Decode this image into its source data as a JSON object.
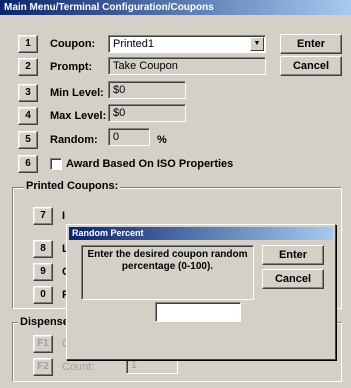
{
  "window": {
    "title": "Main Menu/Terminal Configuration/Coupons"
  },
  "rows": {
    "coupon": {
      "num": "1",
      "label": "Coupon:",
      "value": "Printed1"
    },
    "prompt": {
      "num": "2",
      "label": "Prompt:",
      "value": "Take Coupon"
    },
    "min_level": {
      "num": "3",
      "label": "Min Level:",
      "value": "$0"
    },
    "max_level": {
      "num": "4",
      "label": "Max Level:",
      "value": "$0"
    },
    "random": {
      "num": "5",
      "label": "Random:",
      "value": "0",
      "unit": "%"
    },
    "award": {
      "num": "6",
      "label": "Award Based On ISO Properties"
    }
  },
  "buttons": {
    "enter": "Enter",
    "cancel": "Cancel"
  },
  "printed_coupons": {
    "title": "Printed Coupons:",
    "rows": [
      {
        "num": "7",
        "label": "I"
      },
      {
        "num": "8",
        "label": "L"
      },
      {
        "num": "9",
        "label": "C"
      },
      {
        "num": "0",
        "label": "F"
      }
    ]
  },
  "dispensed": {
    "title": "Dispense",
    "rows": [
      {
        "num": "F1",
        "label": "C"
      },
      {
        "num": "F2",
        "label": "Count:",
        "value": "1"
      }
    ]
  },
  "dialog": {
    "title": "Random Percent",
    "message": "Enter the desired coupon random percentage (0-100).",
    "enter": "Enter",
    "cancel": "Cancel",
    "input_value": ""
  }
}
